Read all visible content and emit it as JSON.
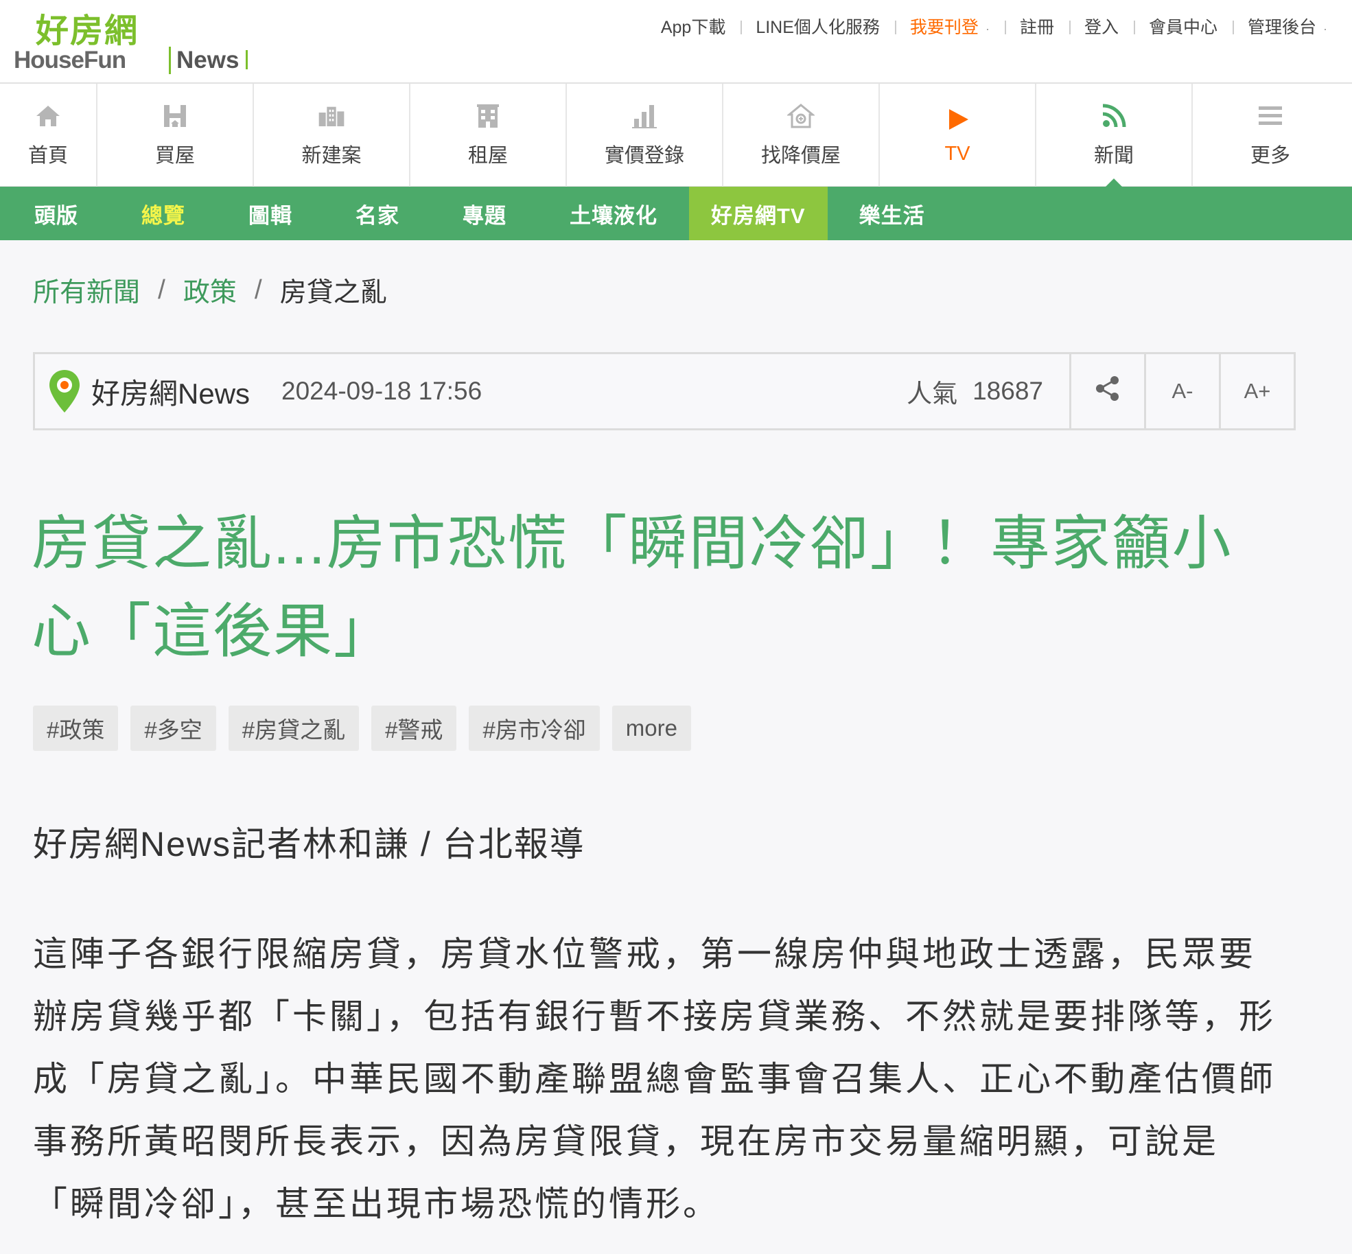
{
  "brand": {
    "logo_cn": "好房網",
    "logo_en": "HouseFun",
    "logo_news": "News",
    "colors": {
      "green": "#4caa6a",
      "lime": "#7cbf2c",
      "orange": "#ff6a00",
      "tab_highlight": "#8dc63f"
    }
  },
  "top_links": [
    {
      "label": "App下載"
    },
    {
      "label": "LINE個人化服務"
    },
    {
      "label": "我要刊登"
    },
    {
      "label": "註冊"
    },
    {
      "label": "登入"
    },
    {
      "label": "會員中心"
    },
    {
      "label": "管理後台"
    }
  ],
  "main_nav": [
    {
      "label": "首頁",
      "icon": "home-icon"
    },
    {
      "label": "買屋",
      "icon": "buy-house-icon"
    },
    {
      "label": "新建案",
      "icon": "buildings-icon"
    },
    {
      "label": "租屋",
      "icon": "rent-building-icon"
    },
    {
      "label": "實價登錄",
      "icon": "bar-chart-icon"
    },
    {
      "label": "找降價屋",
      "icon": "price-drop-house-icon"
    },
    {
      "label": "TV",
      "icon": "play-icon"
    },
    {
      "label": "新聞",
      "icon": "rss-icon"
    },
    {
      "label": "更多",
      "icon": "menu-icon"
    }
  ],
  "sub_nav": [
    {
      "label": "頭版"
    },
    {
      "label": "總覽"
    },
    {
      "label": "圖輯"
    },
    {
      "label": "名家"
    },
    {
      "label": "專題"
    },
    {
      "label": "土壤液化"
    },
    {
      "label": "好房網TV"
    },
    {
      "label": "樂生活"
    }
  ],
  "breadcrumb": {
    "items": [
      "所有新聞",
      "政策",
      "房貸之亂"
    ],
    "separator": "/"
  },
  "article_meta": {
    "source": "好房網News",
    "datetime": "2024-09-18 17:56",
    "popularity_label": "人氣",
    "popularity_value": "18687",
    "font_smaller": "A-",
    "font_larger": "A+"
  },
  "article": {
    "title": "房貸之亂...房市恐慌「瞬間冷卻」！專家籲小心「這後果」",
    "tags": [
      "#政策",
      "#多空",
      "#房貸之亂",
      "#警戒",
      "#房市冷卻"
    ],
    "more_label": "more",
    "byline": "好房網News記者林和謙 / 台北報導",
    "body": "這陣子各銀行限縮房貸，房貸水位警戒，第一線房仲與地政士透露，民眾要辦房貸幾乎都「卡關」，包括有銀行暫不接房貸業務、不然就是要排隊等，形成「房貸之亂」。中華民國不動產聯盟總會監事會召集人、正心不動產估價師事務所黃昭閔所長表示，因為房貸限貸，現在房市交易量縮明顯，可說是「瞬間冷卻」，甚至出現市場恐慌的情形。"
  }
}
